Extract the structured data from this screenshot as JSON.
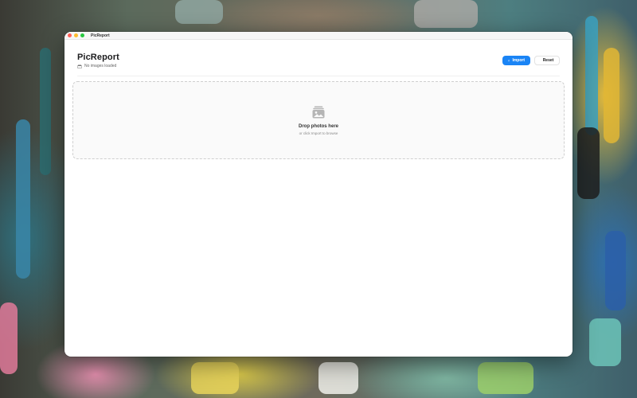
{
  "window": {
    "title": "PicReport"
  },
  "header": {
    "title": "PicReport",
    "status_icon": "photo-stack-icon",
    "status_text": "No images loaded"
  },
  "toolbar": {
    "import_label": "Import",
    "import_icon": "import-tray-icon",
    "reset_label": "Reset",
    "reset_icon": "reset-arrow-icon"
  },
  "dropzone": {
    "icon": "photo-stack-icon",
    "title": "Drop photos here",
    "hint": "or click Import to browse"
  },
  "colors": {
    "accent": "#1a84f5",
    "window_bg": "#ffffff",
    "dropzone_bg": "#fafafa"
  }
}
